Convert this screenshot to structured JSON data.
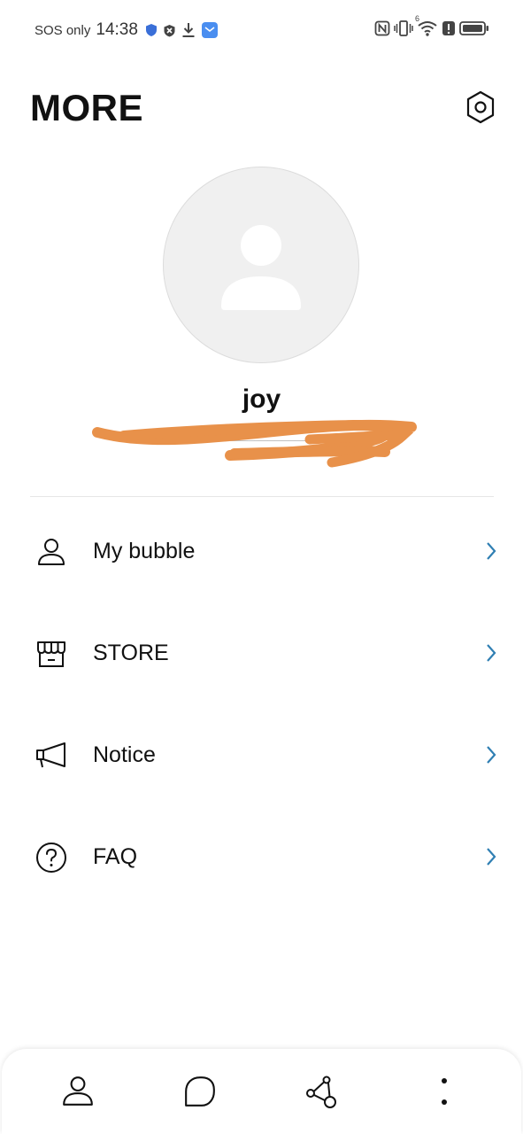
{
  "status_bar": {
    "sos": "SOS only",
    "time": "14:38",
    "left_icons": [
      "shield-icon",
      "blocked-icon",
      "download-icon",
      "app-notification-icon"
    ],
    "right_icons": [
      "nfc-icon",
      "vibrate-icon",
      "wifi-icon",
      "alert-icon",
      "battery-icon"
    ],
    "wifi_badge": "6"
  },
  "header": {
    "title": "MORE",
    "settings_icon": "settings-icon"
  },
  "profile": {
    "name": "joy",
    "email": "________________"
  },
  "menu": [
    {
      "label": "My bubble",
      "icon": "person-icon"
    },
    {
      "label": "STORE",
      "icon": "store-icon"
    },
    {
      "label": "Notice",
      "icon": "megaphone-icon"
    },
    {
      "label": "FAQ",
      "icon": "question-icon"
    }
  ],
  "bottom_nav": [
    {
      "icon": "profile-icon"
    },
    {
      "icon": "chat-icon"
    },
    {
      "icon": "share-icon"
    },
    {
      "icon": "more-icon"
    }
  ],
  "colors": {
    "accent_chevron": "#2f7fb3",
    "scribble": "#e8914a",
    "avatar_bg": "#f0f0f0"
  }
}
